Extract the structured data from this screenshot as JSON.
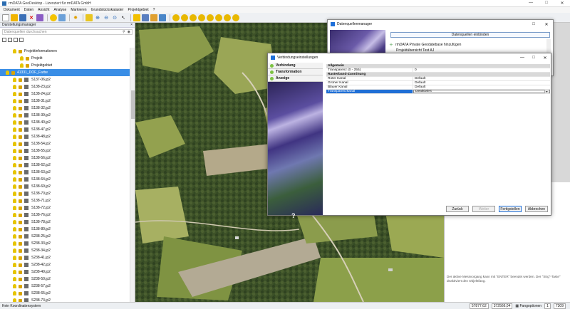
{
  "window": {
    "title": "rmDATA GeoDesktop - Lizenziert für rmDATA GmbH",
    "controls": [
      "—",
      "□",
      "✕"
    ]
  },
  "menu": [
    "Dokument",
    "Daten",
    "Ansicht",
    "Analyse",
    "Markieren",
    "Grundstückskataster",
    "Projektgebiet",
    "?"
  ],
  "left_panel": {
    "title": "Darstellungsmanager",
    "search_placeholder": "Datenquellen durchsuchen",
    "tree": [
      {
        "label": "Projektinformationen",
        "level": 1
      },
      {
        "label": "Projekt",
        "level": 2
      },
      {
        "label": "Projektgebiet",
        "level": 2
      },
      {
        "label": "41331_DOF_Farbe",
        "level": 0,
        "selected": true
      },
      {
        "label": "S137-06.jp2",
        "level": 1
      },
      {
        "label": "S138-23.jp2",
        "level": 1
      },
      {
        "label": "S138-24.jp2",
        "level": 1
      },
      {
        "label": "S138-31.jp2",
        "level": 1
      },
      {
        "label": "S138-32.jp2",
        "level": 1
      },
      {
        "label": "S138-39.jp2",
        "level": 1
      },
      {
        "label": "S138-40.jp2",
        "level": 1
      },
      {
        "label": "S138-47.jp2",
        "level": 1
      },
      {
        "label": "S138-48.jp2",
        "level": 1
      },
      {
        "label": "S138-54.jp2",
        "level": 1
      },
      {
        "label": "S138-55.jp2",
        "level": 1
      },
      {
        "label": "S138-56.jp2",
        "level": 1
      },
      {
        "label": "S138-62.jp2",
        "level": 1
      },
      {
        "label": "S138-63.jp2",
        "level": 1
      },
      {
        "label": "S138-64.jp2",
        "level": 1
      },
      {
        "label": "S138-69.jp2",
        "level": 1
      },
      {
        "label": "S138-70.jp2",
        "level": 1
      },
      {
        "label": "S138-71.jp2",
        "level": 1
      },
      {
        "label": "S138-72.jp2",
        "level": 1
      },
      {
        "label": "S138-76.jp2",
        "level": 1
      },
      {
        "label": "S138-78.jp2",
        "level": 1
      },
      {
        "label": "S138-80.jp2",
        "level": 1
      },
      {
        "label": "S238-25.jp2",
        "level": 1
      },
      {
        "label": "S238-33.jp2",
        "level": 1
      },
      {
        "label": "S238-34.jp2",
        "level": 1
      },
      {
        "label": "S238-41.jp2",
        "level": 1
      },
      {
        "label": "S238-42.jp2",
        "level": 1
      },
      {
        "label": "S238-49.jp2",
        "level": 1
      },
      {
        "label": "S238-50.jp2",
        "level": 1
      },
      {
        "label": "S238-57.jp2",
        "level": 1
      },
      {
        "label": "S238-65.jp2",
        "level": 1
      },
      {
        "label": "S238-73.jp2",
        "level": 1
      }
    ]
  },
  "data_source_manager": {
    "title": "Datenquellenmanager",
    "button": "Datenquellen einbinden",
    "add_item": "rmDATA Private Geodatebase hinzufügen",
    "project_item": "Projektübersicht Test AJ"
  },
  "connection_settings": {
    "title": "Verbindungseinstellungen",
    "nav": [
      "Verbindung",
      "Transformation",
      "Anzeige"
    ],
    "help": "?",
    "grid": [
      {
        "type": "cat",
        "label": "Allgemein"
      },
      {
        "type": "row",
        "key": "Transparenz (0 - 255)",
        "value": "0"
      },
      {
        "type": "cat",
        "label": "Rasterband-Zuordnung"
      },
      {
        "type": "row",
        "key": "Roter Kanal",
        "value": "Default"
      },
      {
        "type": "row",
        "key": "Grüner Kanal",
        "value": "Default"
      },
      {
        "type": "row",
        "key": "Blauer Kanal",
        "value": "Default"
      },
      {
        "type": "sel",
        "key": "Transparenzkanal",
        "value": "Deaktiviert"
      }
    ],
    "buttons": {
      "back": "Zurück",
      "next": "Weiter",
      "finish": "Fertigstellen",
      "cancel": "Abbrechen"
    }
  },
  "info_message": "Der aktive Messvorgang kann mit \"ENTER\" beendet werden. Der \"Strg\"-Taste\" deaktiviert den Objektfang.",
  "status": {
    "left": "Kein Koordinatensystem",
    "x": "57877,62",
    "y": "372566,04",
    "snap": "Fangoptionen",
    "page": "1",
    "scale": "7309"
  }
}
